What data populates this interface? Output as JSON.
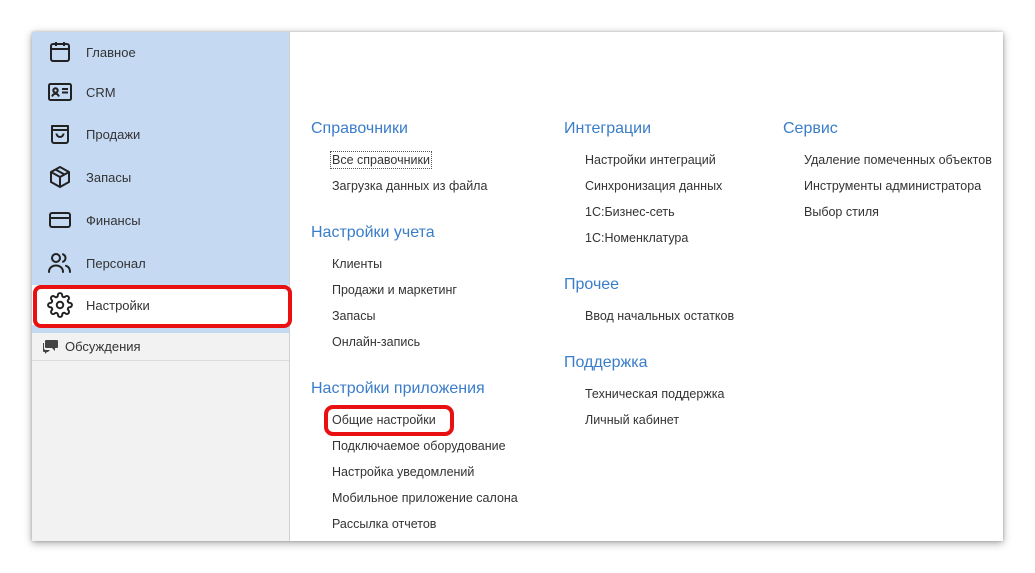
{
  "sidebar": {
    "items": [
      {
        "label": "Главное",
        "icon": "calendar-icon"
      },
      {
        "label": "CRM",
        "icon": "id-card-icon"
      },
      {
        "label": "Продажи",
        "icon": "shopping-bag-icon"
      },
      {
        "label": "Запасы",
        "icon": "box-icon"
      },
      {
        "label": "Финансы",
        "icon": "credit-card-icon"
      },
      {
        "label": "Персонал",
        "icon": "users-icon"
      },
      {
        "label": "Настройки",
        "icon": "gear-icon"
      }
    ],
    "discussions": {
      "label": "Обсуждения",
      "icon": "chat-icon"
    }
  },
  "sections": {
    "references": {
      "title": "Справочники",
      "items": [
        "Все справочники",
        "Загрузка данных из файла"
      ]
    },
    "account_settings": {
      "title": "Настройки учета",
      "items": [
        "Клиенты",
        "Продажи и маркетинг",
        "Запасы",
        "Онлайн-запись"
      ]
    },
    "app_settings": {
      "title": "Настройки приложения",
      "items": [
        "Общие настройки",
        "Подключаемое оборудование",
        "Настройка уведомлений",
        "Мобильное приложение салона",
        "Рассылка отчетов"
      ]
    },
    "integrations": {
      "title": "Интеграции",
      "items": [
        "Настройки интеграций",
        "Синхронизация данных",
        "1С:Бизнес-сеть",
        "1С:Номенклатура"
      ]
    },
    "other": {
      "title": "Прочее",
      "items": [
        "Ввод начальных остатков"
      ]
    },
    "support": {
      "title": "Поддержка",
      "items": [
        "Техническая поддержка",
        "Личный кабинет"
      ]
    },
    "service": {
      "title": "Сервис",
      "items": [
        "Удаление помеченных объектов",
        "Инструменты администратора",
        "Выбор стиля"
      ]
    }
  },
  "colors": {
    "accent": "#3a7dc9",
    "sidebar_bg": "#c5d9f3",
    "highlight": "#e81010"
  }
}
